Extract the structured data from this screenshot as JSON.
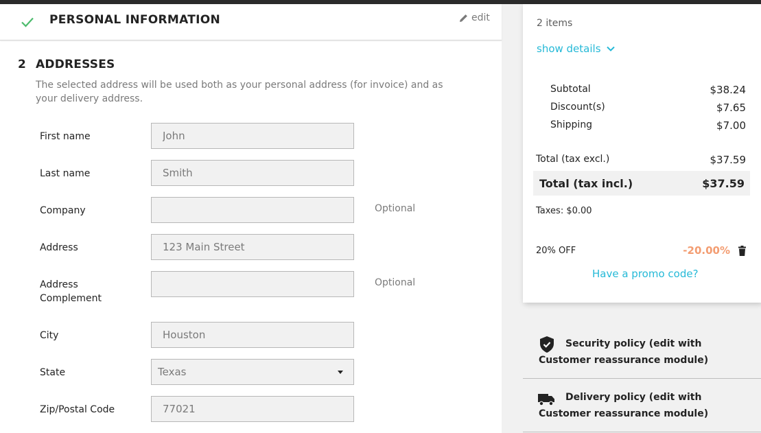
{
  "personal_step": {
    "title": "PERSONAL INFORMATION",
    "edit_label": "edit"
  },
  "addresses_step": {
    "number": "2",
    "title": "ADDRESSES",
    "description": "The selected address will be used both as your personal address (for invoice) and as your delivery address."
  },
  "form": {
    "first_name": {
      "label": "First name",
      "value": "John"
    },
    "last_name": {
      "label": "Last name",
      "value": "Smith"
    },
    "company": {
      "label": "Company",
      "value": "",
      "optional": "Optional"
    },
    "address": {
      "label": "Address",
      "value": "123 Main Street"
    },
    "address_complement": {
      "label_line1": "Address",
      "label_line2": "Complement",
      "value": "",
      "optional": "Optional"
    },
    "city": {
      "label": "City",
      "value": "Houston"
    },
    "state": {
      "label": "State",
      "selected": "Texas"
    },
    "zip": {
      "label": "Zip/Postal Code",
      "value": "77021"
    }
  },
  "summary": {
    "items_count": "2 items",
    "show_details": "show details",
    "subtotal_label": "Subtotal",
    "subtotal_value": "$38.24",
    "discount_label": "Discount(s)",
    "discount_value": "$7.65",
    "shipping_label": "Shipping",
    "shipping_value": "$7.00",
    "total_excl_label": "Total (tax excl.)",
    "total_excl_value": "$37.59",
    "total_incl_label": "Total (tax incl.)",
    "total_incl_value": "$37.59",
    "taxes": "Taxes: $0.00",
    "promo_name": "20% OFF",
    "promo_value": "-20.00%",
    "promo_link": "Have a promo code?"
  },
  "reassurance": {
    "security": "Security policy (edit with Customer reassurance module)",
    "delivery": "Delivery policy (edit with Customer reassurance module)"
  },
  "colors": {
    "accent": "#25b9d7",
    "discount": "#f39d72",
    "check": "#4cbb6c"
  }
}
